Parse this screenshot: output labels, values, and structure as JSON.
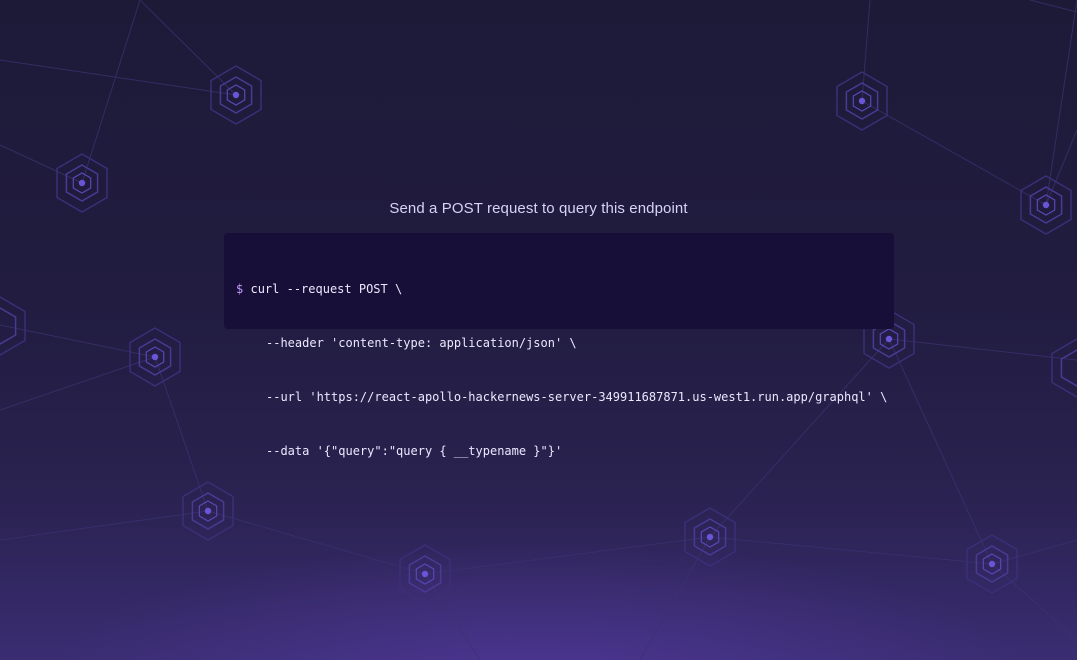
{
  "page": {
    "heading": "Send a POST request to query this endpoint"
  },
  "code": {
    "prompt": "$",
    "lines": [
      "curl --request POST \\",
      "--header 'content-type: application/json' \\",
      "--url 'https://react-apollo-hackernews-server-349911687871.us-west1.run.app/graphql' \\",
      "--data '{\"query\":\"query { __typename }\"}'"
    ]
  },
  "colors": {
    "background": "#1e1a3a",
    "code_background": "#170f38",
    "node_accent": "#6b55d6",
    "prompt": "#c59cff"
  },
  "icons": {
    "background_nodes": "hexagon-node-icon"
  }
}
